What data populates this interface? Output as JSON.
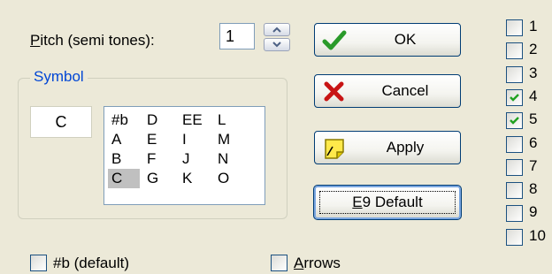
{
  "pitch": {
    "label_mnemonic": "P",
    "label_rest": "itch (semi tones):",
    "value": "1"
  },
  "symbol": {
    "legend": "Symbol",
    "current": "C",
    "items": [
      "#b",
      "A",
      "B",
      "C",
      "D",
      "E",
      "F",
      "G",
      "EE",
      "I",
      "J",
      "K",
      "L",
      "M",
      "N",
      "O"
    ],
    "selected": "C"
  },
  "buttons": {
    "ok": "OK",
    "cancel": "Cancel",
    "apply": "Apply",
    "default_mnemonic": "E",
    "default_rest": "9 Default"
  },
  "options": {
    "b_default": {
      "label": "#b (default)",
      "checked": false
    },
    "arrows": {
      "label_mnemonic": "A",
      "label_rest": "rrows",
      "checked": false
    }
  },
  "channels": [
    {
      "label": "1",
      "checked": false
    },
    {
      "label": "2",
      "checked": false
    },
    {
      "label": "3",
      "checked": false
    },
    {
      "label": "4",
      "checked": true
    },
    {
      "label": "5",
      "checked": true
    },
    {
      "label": "6",
      "checked": false
    },
    {
      "label": "7",
      "checked": false
    },
    {
      "label": "8",
      "checked": false
    },
    {
      "label": "9",
      "checked": false
    },
    {
      "label": "10",
      "checked": false
    }
  ],
  "colors": {
    "accent": "#0046d5",
    "check": "#21a121",
    "selection": "#c0c0c0"
  }
}
